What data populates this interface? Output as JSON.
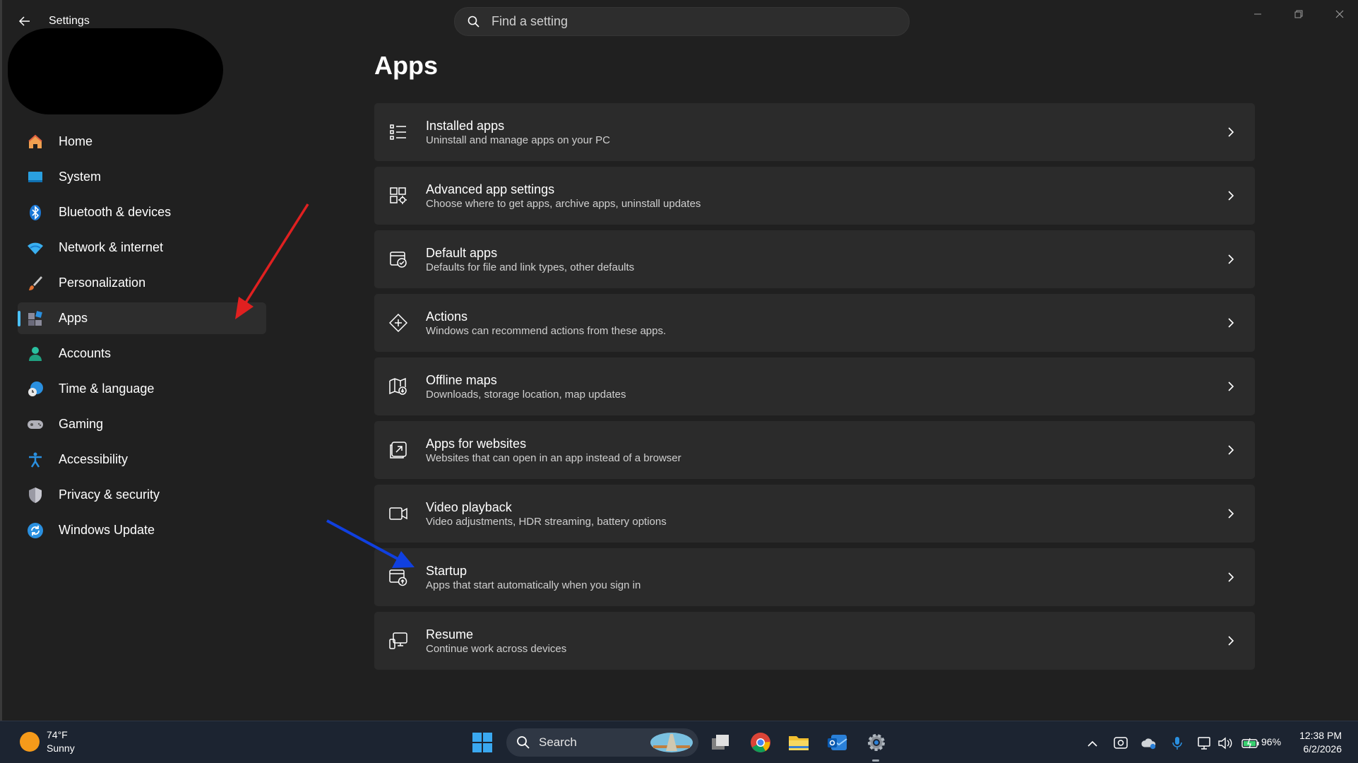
{
  "window": {
    "app_title": "Settings",
    "search_placeholder": "Find a setting"
  },
  "sidebar": {
    "items": [
      {
        "label": "Home",
        "icon": "home-icon"
      },
      {
        "label": "System",
        "icon": "system-icon"
      },
      {
        "label": "Bluetooth & devices",
        "icon": "bluetooth-icon"
      },
      {
        "label": "Network & internet",
        "icon": "wifi-icon"
      },
      {
        "label": "Personalization",
        "icon": "brush-icon"
      },
      {
        "label": "Apps",
        "icon": "apps-icon",
        "selected": true
      },
      {
        "label": "Accounts",
        "icon": "person-icon"
      },
      {
        "label": "Time & language",
        "icon": "clock-globe-icon"
      },
      {
        "label": "Gaming",
        "icon": "gamepad-icon"
      },
      {
        "label": "Accessibility",
        "icon": "accessibility-icon"
      },
      {
        "label": "Privacy & security",
        "icon": "shield-icon"
      },
      {
        "label": "Windows Update",
        "icon": "update-icon"
      }
    ]
  },
  "main": {
    "title": "Apps",
    "cards": [
      {
        "title": "Installed apps",
        "subtitle": "Uninstall and manage apps on your PC",
        "icon": "list-icon"
      },
      {
        "title": "Advanced app settings",
        "subtitle": "Choose where to get apps, archive apps, uninstall updates",
        "icon": "app-settings-icon"
      },
      {
        "title": "Default apps",
        "subtitle": "Defaults for file and link types, other defaults",
        "icon": "default-apps-icon"
      },
      {
        "title": "Actions",
        "subtitle": "Windows can recommend actions from these apps.",
        "icon": "actions-icon"
      },
      {
        "title": "Offline maps",
        "subtitle": "Downloads, storage location, map updates",
        "icon": "map-icon"
      },
      {
        "title": "Apps for websites",
        "subtitle": "Websites that can open in an app instead of a browser",
        "icon": "open-in-app-icon"
      },
      {
        "title": "Video playback",
        "subtitle": "Video adjustments, HDR streaming, battery options",
        "icon": "video-icon"
      },
      {
        "title": "Startup",
        "subtitle": "Apps that start automatically when you sign in",
        "icon": "startup-icon"
      },
      {
        "title": "Resume",
        "subtitle": "Continue work across devices",
        "icon": "resume-icon"
      }
    ]
  },
  "annotations": {
    "red_arrow_color": "#e02020",
    "blue_arrow_color": "#1040e0"
  },
  "taskbar": {
    "weather_temp": "74°F",
    "weather_desc": "Sunny",
    "search_label": "Search",
    "battery": "96%",
    "time": "12:38 PM",
    "date": "6/2/2026"
  },
  "colors": {
    "accent": "#4cc2ff",
    "background": "#202020",
    "card": "#2b2b2b"
  }
}
